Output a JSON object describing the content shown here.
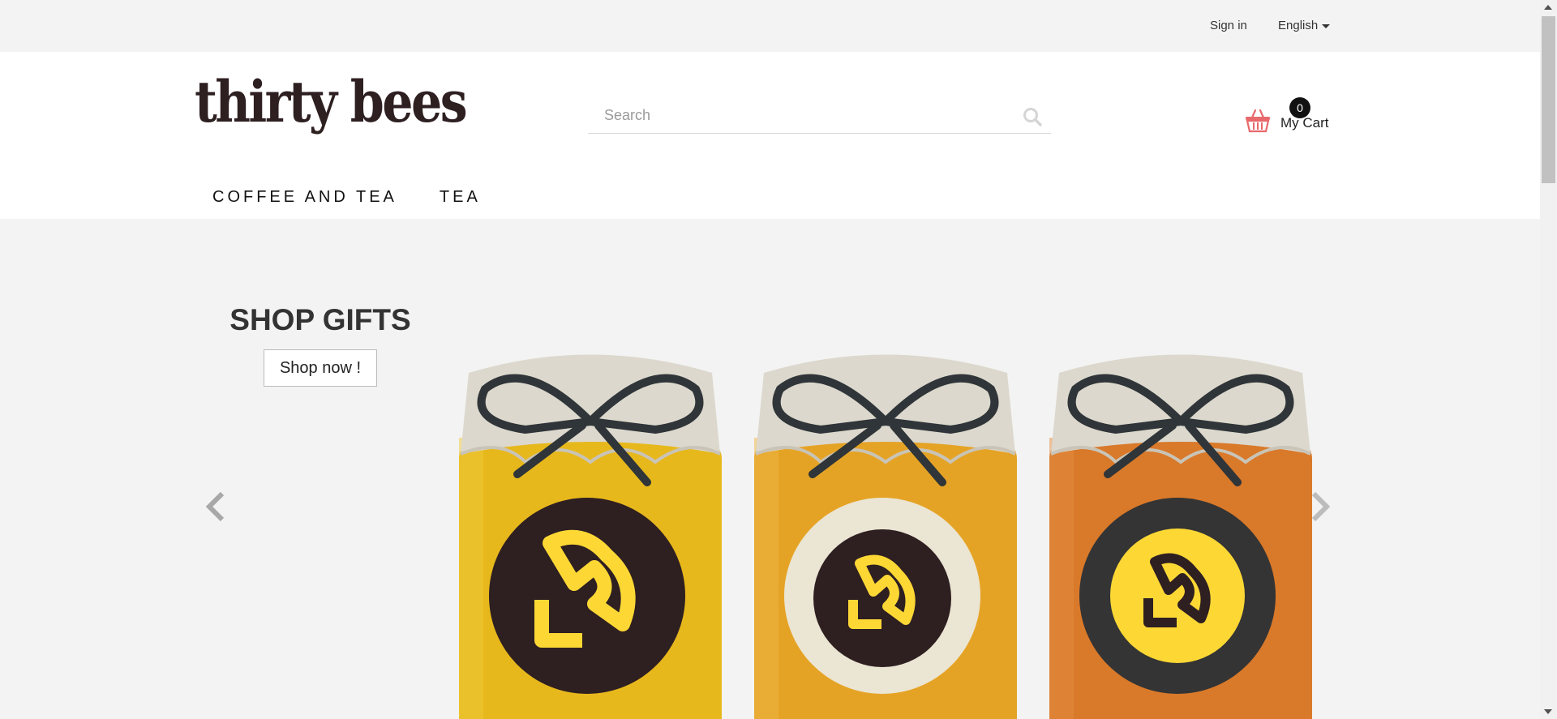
{
  "topbar": {
    "signin_label": "Sign in",
    "language_label": "English"
  },
  "header": {
    "logo_text": "thirty bees",
    "search": {
      "placeholder": "Search"
    },
    "cart": {
      "count": "0",
      "label": "My Cart",
      "icon": "basket-icon",
      "icon_color": "#e8696b"
    }
  },
  "nav": {
    "items": [
      {
        "label": "COFFEE AND TEA"
      },
      {
        "label": "TEA"
      }
    ]
  },
  "hero": {
    "title": "SHOP GIFTS",
    "button_label": "Shop now !",
    "prev_icon": "chevron-left-icon",
    "next_icon": "chevron-right-icon"
  },
  "colors": {
    "page_bg": "#f3f3f3",
    "header_bg": "#ffffff",
    "logo_dark": "#2e1f21",
    "honey_1": "#e7b81c",
    "honey_2": "#e5a325",
    "honey_3": "#d9792a",
    "bee_yellow": "#fdd835"
  }
}
